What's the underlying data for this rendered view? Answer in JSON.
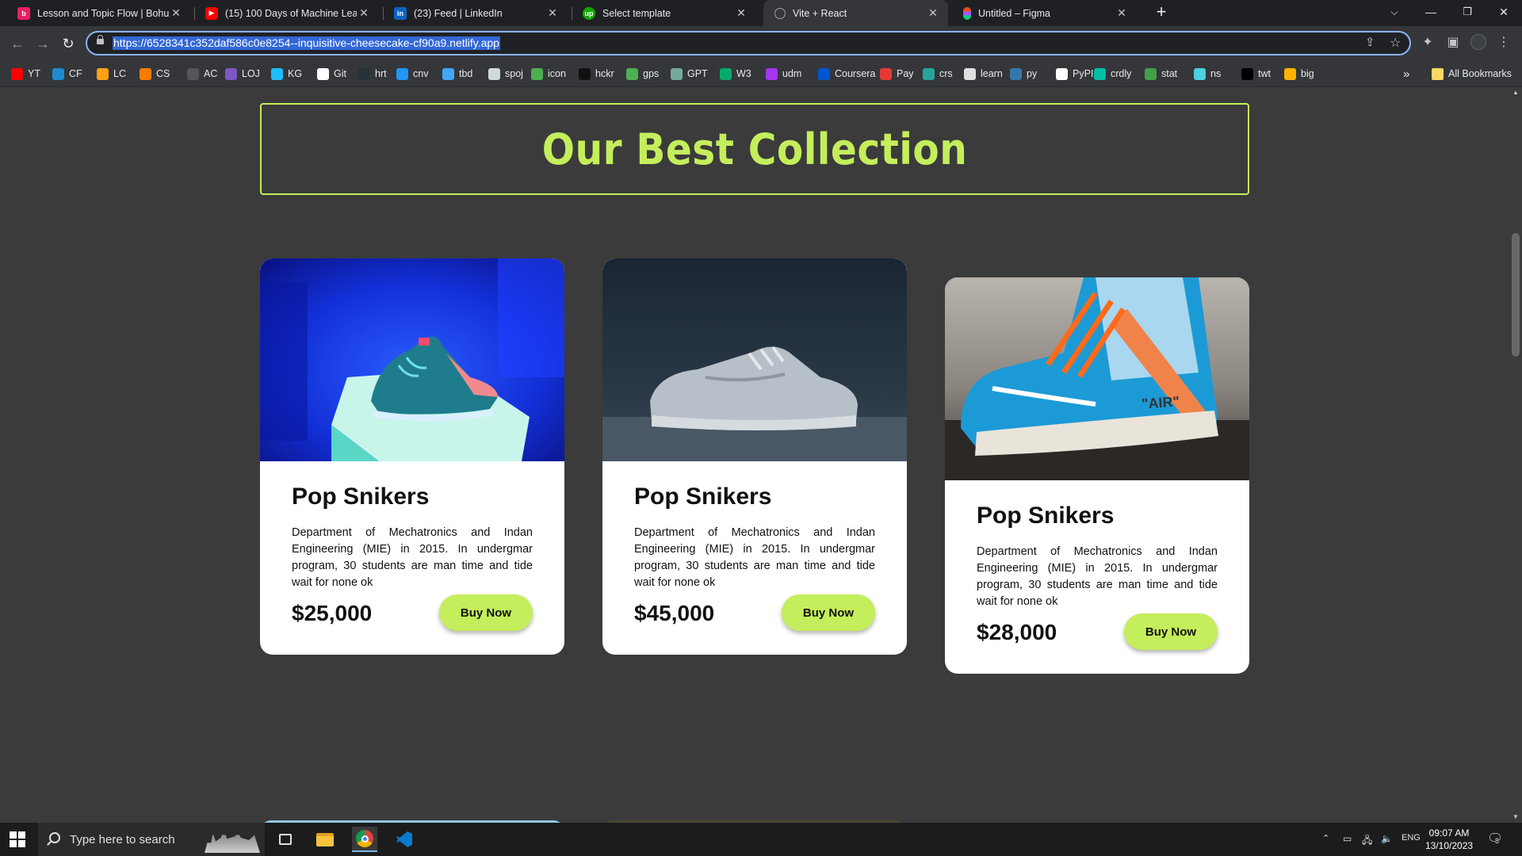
{
  "browser": {
    "tabs": [
      {
        "title": "Lesson and Topic Flow | Bohubri",
        "icon": "bohubrihi-icon",
        "color": "#e91e63",
        "active": false
      },
      {
        "title": "(15) 100 Days of Machine Learni",
        "icon": "youtube-icon",
        "color": "#ff0000",
        "active": false
      },
      {
        "title": "(23) Feed | LinkedIn",
        "icon": "linkedin-icon",
        "color": "#0a66c2",
        "active": false
      },
      {
        "title": "Select template",
        "icon": "upwork-icon",
        "color": "#14a800",
        "active": false
      },
      {
        "title": "Vite + React",
        "icon": "globe-icon",
        "color": "#9aa0a6",
        "active": true
      },
      {
        "title": "Untitled – Figma",
        "icon": "figma-icon",
        "color": "#f24e1e",
        "active": false
      }
    ],
    "url": "https://6528341c352daf586c0e8254--inquisitive-cheesecake-cf90a9.netlify.app",
    "bookmarks": [
      {
        "label": "YT",
        "color": "#ff0000"
      },
      {
        "label": "CF",
        "color": "#1f8acb"
      },
      {
        "label": "LC",
        "color": "#ffa116"
      },
      {
        "label": "CS",
        "color": "#f57c00"
      },
      {
        "label": "AC",
        "color": "#555555"
      },
      {
        "label": "LOJ",
        "color": "#7e57c2"
      },
      {
        "label": "KG",
        "color": "#20beff"
      },
      {
        "label": "Git",
        "color": "#ffffff"
      },
      {
        "label": "hrt",
        "color": "#263238"
      },
      {
        "label": "cnv",
        "color": "#2196f3"
      },
      {
        "label": "tbd",
        "color": "#42a5f5"
      },
      {
        "label": "spoj",
        "color": "#cfd8dc"
      },
      {
        "label": "icon",
        "color": "#4caf50"
      },
      {
        "label": "hckr",
        "color": "#111111"
      },
      {
        "label": "gps",
        "color": "#4caf50"
      },
      {
        "label": "GPT",
        "color": "#74aa9c"
      },
      {
        "label": "W3",
        "color": "#04aa6d"
      },
      {
        "label": "udm",
        "color": "#a435f0"
      },
      {
        "label": "Coursera",
        "color": "#0056d2"
      },
      {
        "label": "Pay",
        "color": "#e53935"
      },
      {
        "label": "crs",
        "color": "#26a69a"
      },
      {
        "label": "learn",
        "color": "#e0e0e0"
      },
      {
        "label": "py",
        "color": "#3776ab"
      },
      {
        "label": "PyPI",
        "color": "#ffffff"
      },
      {
        "label": "crdly",
        "color": "#00bfa5"
      },
      {
        "label": "stat",
        "color": "#43a047"
      },
      {
        "label": "ns",
        "color": "#4dd0e1"
      },
      {
        "label": "twt",
        "color": "#000000"
      },
      {
        "label": "big",
        "color": "#ffb300"
      }
    ],
    "all_bookmarks_label": "All Bookmarks",
    "more_bookmarks": "»"
  },
  "page": {
    "heading": "Our Best Collection",
    "accent_color": "#c4ee5b",
    "products": [
      {
        "name": "Pop Snikers",
        "description": "Department of Mechatronics and Indan Engineering (MIE) in 2015. In undergmar program, 30 students are man time and tide wait for none ok",
        "price": "$25,000",
        "button": "Buy Now",
        "image": "blue-neon-sneaker-photo"
      },
      {
        "name": "Pop Snikers",
        "description": "Department of Mechatronics and Indan Engineering (MIE) in 2015. In undergmar program, 30 students are man time and tide wait for none ok",
        "price": "$45,000",
        "button": "Buy Now",
        "image": "white-sneaker-photo"
      },
      {
        "name": "Pop Snikers",
        "description": "Department of Mechatronics and Indan Engineering (MIE) in 2015. In undergmar program, 30 students are man time and tide wait for none ok",
        "price": "$28,000",
        "button": "Buy Now",
        "image": "blue-air-jordan-photo",
        "image_text": "\"AIR\""
      }
    ]
  },
  "taskbar": {
    "search_placeholder": "Type here to search",
    "language": "ENG",
    "time": "09:07 AM",
    "date": "13/10/2023",
    "notification_count": "8"
  }
}
